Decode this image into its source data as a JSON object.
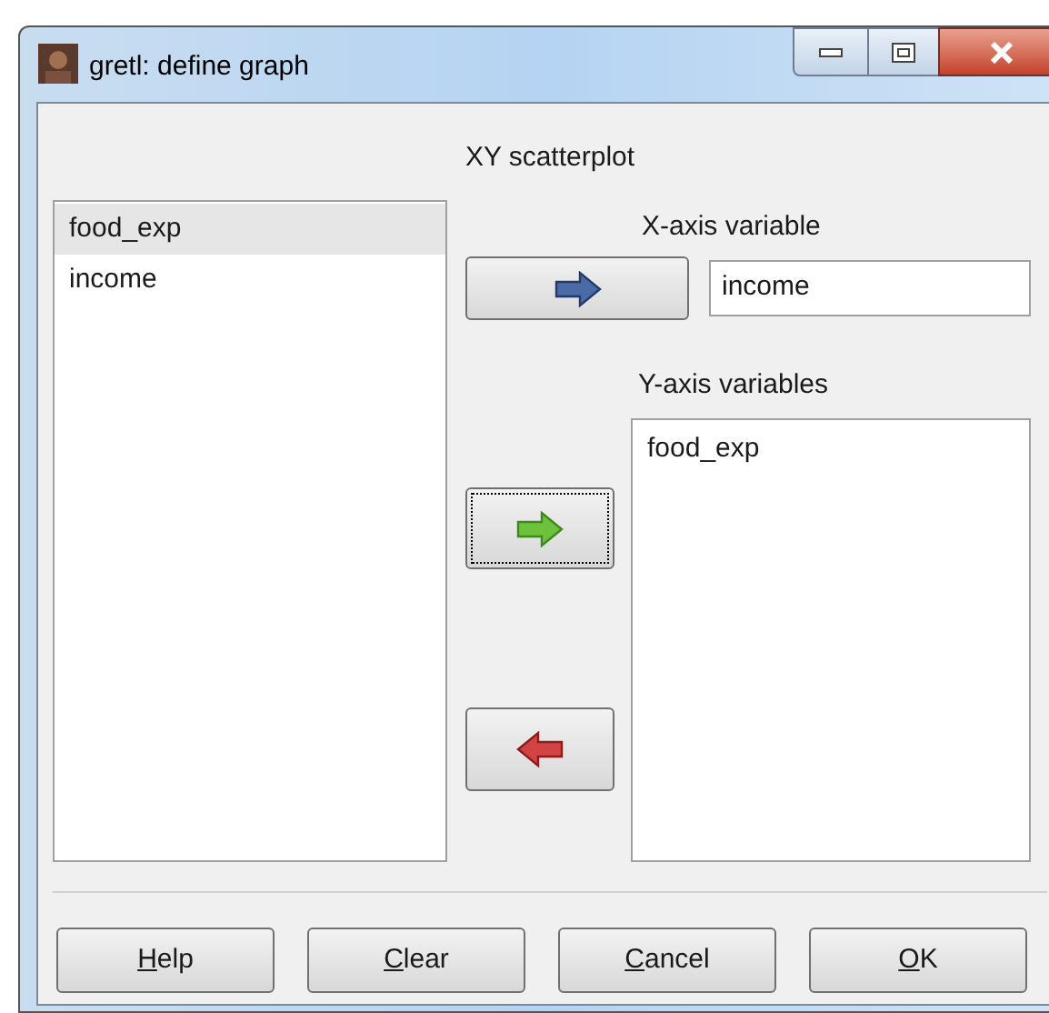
{
  "window": {
    "title": "gretl: define graph"
  },
  "heading": "XY scatterplot",
  "variables": [
    {
      "name": "food_exp",
      "selected": true
    },
    {
      "name": "income",
      "selected": false
    }
  ],
  "x_axis": {
    "label": "X-axis variable",
    "value": "income"
  },
  "y_axis": {
    "label": "Y-axis variables",
    "items": [
      {
        "name": "food_exp",
        "selected": false
      }
    ]
  },
  "arrow_buttons": [
    {
      "kind": "set-x",
      "focused": false
    },
    {
      "kind": "add-y",
      "focused": true
    },
    {
      "kind": "remove-y",
      "focused": false
    }
  ],
  "buttons": [
    {
      "accel": "H",
      "rest": "elp"
    },
    {
      "accel": "C",
      "rest": "lear"
    },
    {
      "accel": "C",
      "rest": "ancel"
    },
    {
      "accel": "O",
      "rest": "K"
    }
  ]
}
